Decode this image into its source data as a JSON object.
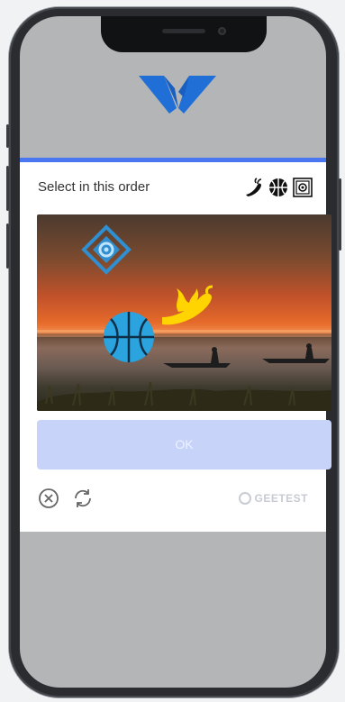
{
  "captcha": {
    "prompt": "Select in this order",
    "targets": [
      "chili-pepper-icon",
      "basketball-icon",
      "target-square-icon"
    ],
    "ok_label": "OK",
    "close_icon": "close-circle-icon",
    "refresh_icon": "refresh-icon"
  },
  "brand": {
    "name": "GEETEST"
  },
  "colors": {
    "accent": "#4a76f2",
    "ok_disabled": "#c7d3f9",
    "logo_blue": "#1f6fd6",
    "icon_cyan": "#2aa3df",
    "icon_yellow": "#ffd400"
  }
}
